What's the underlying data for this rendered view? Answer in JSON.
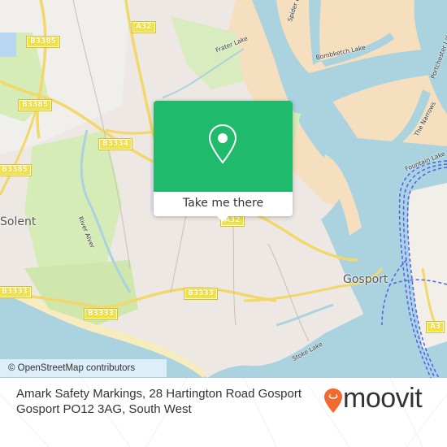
{
  "map": {
    "attribution": "© OpenStreetMap contributors",
    "road_shields": [
      "B3385",
      "A32",
      "B3385",
      "B3385",
      "B3334",
      "B3333",
      "B3333",
      "B3333",
      "A32",
      "A3"
    ],
    "water_labels": [
      "Frater Lake",
      "Spider Lake",
      "Bombketch Lake",
      "Portchester Lake",
      "The Narrows",
      "Fountain Lake",
      "River Alver",
      "Stoke Lake"
    ],
    "place_labels": [
      "Solent",
      "Gosport"
    ],
    "colors": {
      "land": "#ede8e4",
      "water": "#aad3df",
      "mudflat": "#f5dfbe",
      "park": "#d6ecb7",
      "shield": "#f3e33a",
      "ferry_route": "#4e5ef0"
    }
  },
  "popup": {
    "icon": "map-pin-icon",
    "button_label": "Take me there",
    "color": "#1fba6c"
  },
  "footer": {
    "address_line1": "Amark Safety Markings, 28 Hartington Road Gosport",
    "address_line2": "Gosport PO12 3AG, South West",
    "brand": "moovit",
    "brand_color": "#f26a2f"
  }
}
